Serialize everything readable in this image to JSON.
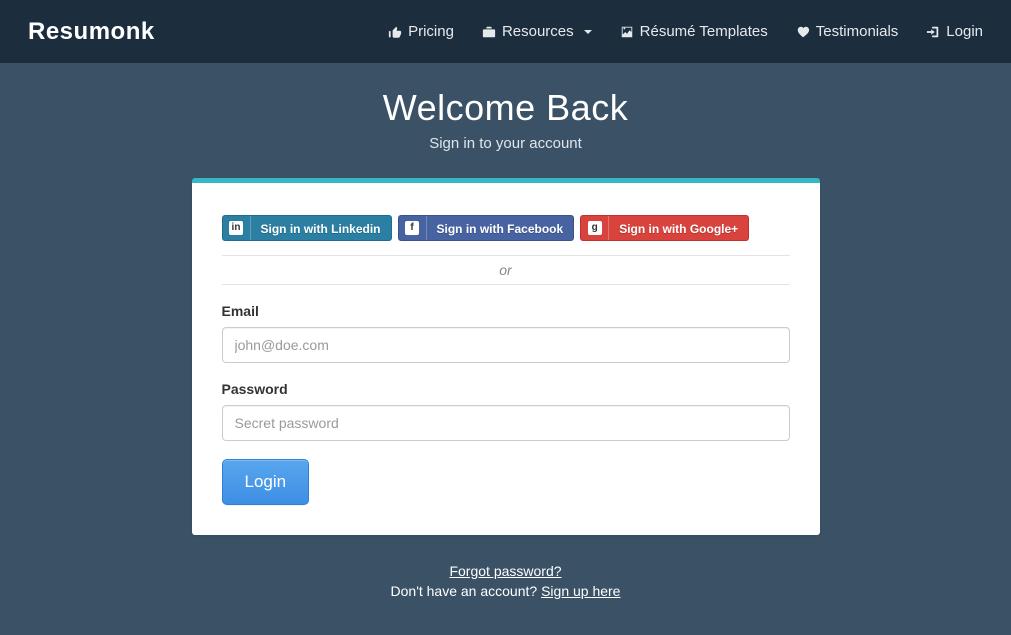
{
  "brand": "Resumonk",
  "nav": {
    "pricing": "Pricing",
    "resources": "Resources",
    "templates": "Résumé Templates",
    "testimonials": "Testimonials",
    "login": "Login"
  },
  "hero": {
    "title": "Welcome Back",
    "subtitle": "Sign in to your account"
  },
  "social": {
    "linkedin": {
      "label": "Sign in with Linkedin",
      "glyph": "in"
    },
    "facebook": {
      "label": "Sign in with Facebook",
      "glyph": "f"
    },
    "google": {
      "label": "Sign in with Google+",
      "glyph": "g"
    }
  },
  "divider_text": "or",
  "form": {
    "email_label": "Email",
    "email_placeholder": "john@doe.com",
    "password_label": "Password",
    "password_placeholder": "Secret password",
    "login_label": "Login"
  },
  "footer": {
    "forgot": "Forgot password?",
    "no_account_prefix": "Don't have an account? ",
    "signup": "Sign up here"
  }
}
